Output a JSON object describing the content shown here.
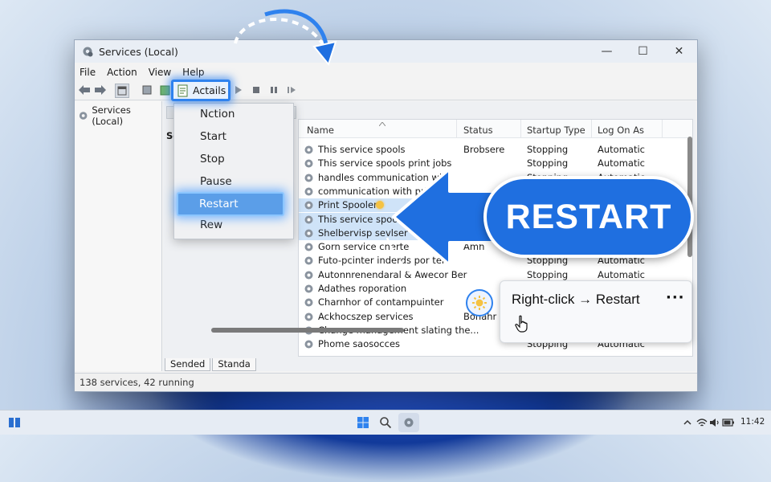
{
  "window": {
    "title": "Services (Local)",
    "controls": [
      "—",
      "☐",
      "✕"
    ]
  },
  "menubar": [
    "File",
    "Action",
    "View",
    "Help"
  ],
  "toolbar": {
    "highlighted_label": "Actails"
  },
  "tree": {
    "item": "Services (Local)"
  },
  "content_header_label": "Se",
  "dropdown": {
    "items": [
      "Nction",
      "Start",
      "Stop",
      "Pause"
    ],
    "restart": "Restart",
    "last": "Rew"
  },
  "columns": {
    "name": "Name",
    "status": "Status",
    "startup": "Startup Type",
    "logon": "Log On As"
  },
  "rows": [
    {
      "name": "This service spools",
      "status": "Brobsere",
      "startup": "Stopping",
      "logon": "Automatic"
    },
    {
      "name": "This service spools print jobs",
      "status": "",
      "startup": "Stopping",
      "logon": "Automatic"
    },
    {
      "name": "handles communication with",
      "status": "",
      "startup": "Stopping",
      "logon": "Automatic"
    },
    {
      "name": "communication with printe",
      "status": "",
      "startup": "",
      "logon": ""
    },
    {
      "name": "Print Spooler",
      "status": "",
      "startup": "",
      "logon": ""
    },
    {
      "name": "This service spool",
      "status": "",
      "startup": "",
      "logon": ""
    },
    {
      "name": "Shelbervisp sevlser",
      "status": "",
      "startup": "",
      "logon": ""
    },
    {
      "name": "Gorn service cnerte",
      "status": "Amh",
      "startup": "",
      "logon": ""
    },
    {
      "name": "Futo-pcinter inderds por tele",
      "status": "",
      "startup": "Stopping",
      "logon": "Automatic"
    },
    {
      "name": "Autonnrenendaral & Awecor Ber",
      "status": "",
      "startup": "Stopping",
      "logon": "Automatic"
    },
    {
      "name": "Adathes roporation",
      "status": "",
      "startup": "",
      "logon": ""
    },
    {
      "name": "Charnhor of contampuinter",
      "status": "",
      "startup": "",
      "logon": ""
    },
    {
      "name": "Ackhocszep services",
      "status": "Bonahr",
      "startup": "",
      "logon": ""
    },
    {
      "name": "Change management slating the...",
      "status": "",
      "startup": "",
      "logon": ""
    },
    {
      "name": "Phome saosocces",
      "status": "",
      "startup": "Stopping",
      "logon": "Automatic"
    }
  ],
  "tabs": [
    "Sended",
    "Standa"
  ],
  "statusbar": "138 services, 42 running",
  "callout": {
    "label": "RESTART"
  },
  "tooltip": {
    "text": "Right-click → Restart",
    "more": "···"
  },
  "taskbar": {
    "clock": "11:42"
  },
  "colors": {
    "accent": "#1f6fe0",
    "highlight": "#2f82ee",
    "selection": "#cfe3f8"
  },
  "icons": [
    "app-gear-icon",
    "back-icon",
    "forward-icon",
    "play-icon",
    "stop-icon",
    "pause-icon",
    "resume-icon",
    "sun-icon",
    "cursor-hand-icon",
    "start-menu-icon",
    "search-icon",
    "wifi-icon",
    "volume-icon",
    "battery-icon"
  ]
}
